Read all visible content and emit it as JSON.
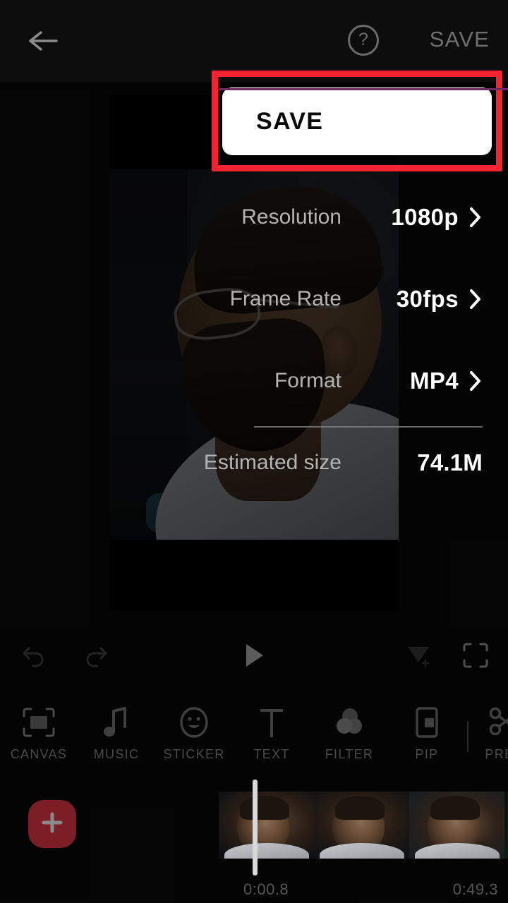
{
  "topbar": {
    "back_icon": "arrow-left-icon",
    "help_icon": "help-circle-icon",
    "help_glyph": "?",
    "save_label": "SAVE"
  },
  "export_dialog": {
    "save_button_label": "SAVE",
    "settings": [
      {
        "label": "Resolution",
        "value": "1080p",
        "has_chevron": true
      },
      {
        "label": "Frame Rate",
        "value": "30fps",
        "has_chevron": true
      },
      {
        "label": "Format",
        "value": "MP4",
        "has_chevron": true
      },
      {
        "label": "Estimated size",
        "value": "74.1M",
        "has_chevron": false
      }
    ]
  },
  "annotation": {
    "color": "#f5232f",
    "target": "save-button"
  },
  "player_controls": [
    {
      "name": "undo-icon"
    },
    {
      "name": "redo-icon"
    },
    {
      "name": "play-icon"
    },
    {
      "name": "add-keyframe-icon"
    },
    {
      "name": "fullscreen-icon"
    }
  ],
  "toolbar": {
    "items": [
      {
        "label": "CANVAS",
        "icon": "canvas-icon"
      },
      {
        "label": "MUSIC",
        "icon": "music-note-icon"
      },
      {
        "label": "STICKER",
        "icon": "smiley-icon"
      },
      {
        "label": "TEXT",
        "icon": "text-t-icon"
      },
      {
        "label": "FILTER",
        "icon": "filter-circles-icon"
      },
      {
        "label": "PIP",
        "icon": "pip-icon"
      },
      {
        "label": "PREC",
        "icon": "scissors-icon"
      }
    ]
  },
  "timeline": {
    "add_clip_label": "+",
    "add_clip_color": "#7c1e26",
    "current_time": "0:00.8",
    "total_time": "0:49.3",
    "clip_count": 4
  }
}
